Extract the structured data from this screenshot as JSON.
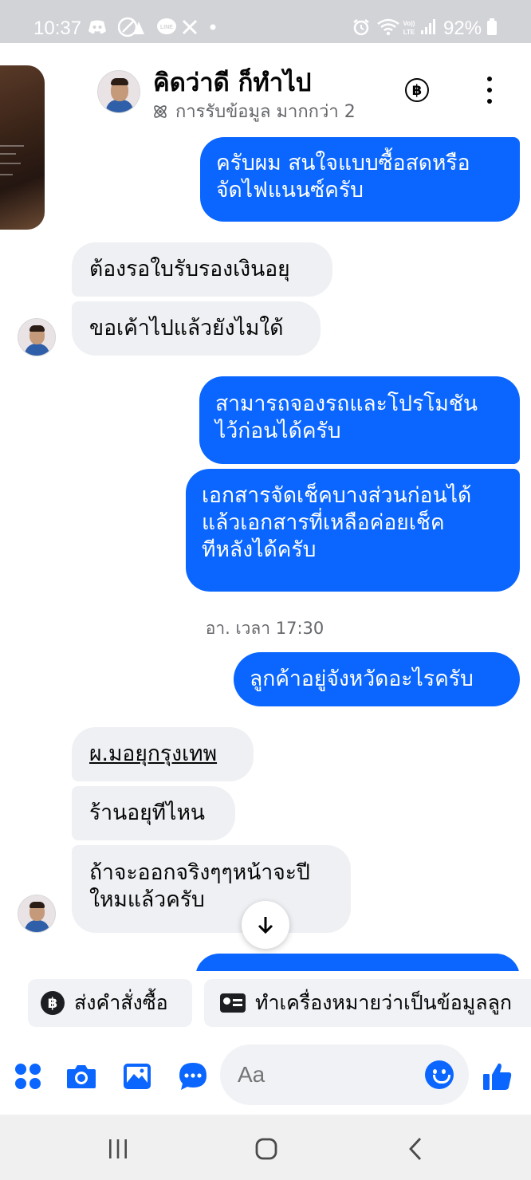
{
  "status_bar": {
    "time": "10:37",
    "battery": "92%",
    "notification_icons": [
      "discord-icon",
      "direction-icon",
      "line-icon",
      "x-icon",
      "dot-icon"
    ],
    "system_icons": [
      "alarm-icon",
      "wifi-icon",
      "volte-icon",
      "signal-icon",
      "battery-icon"
    ]
  },
  "header": {
    "title": "คิดว่าดี ก็ทำไป",
    "subtitle": "การรับข้อมูล มากกว่า 2",
    "baht_symbol": "฿"
  },
  "messages": [
    {
      "direction": "out",
      "text": "ครับผม สนใจแบบซื้อสดหรือ\nจัดไฟแนนซ์ครับ"
    },
    {
      "direction": "in",
      "text": "ต้องรอใบรับรองเงินอยุ"
    },
    {
      "direction": "in",
      "text": "ขอเค้าไปแล้วยังไมใด้"
    },
    {
      "direction": "out",
      "text": "สามารถจองรถและโปรโมชัน\nไว้ก่อนได้ครับ"
    },
    {
      "direction": "out",
      "text": "เอกสารจัดเช็คบางส่วนก่อนได้\nแล้วเอกสารที่เหลือค่อยเช็ค\nทีหลังได้ครับ"
    },
    {
      "direction": "out",
      "text": "ลูกค้าอยู่จังหวัดอะไรครับ"
    },
    {
      "direction": "in",
      "text": "ผ.มอยุกรุงเทพ"
    },
    {
      "direction": "in",
      "text": "ร้านอยุทีไหน"
    },
    {
      "direction": "in",
      "text": "ถ้าจะออกจริงๆๆหน้าจะปี\nใหมแล้วครับ"
    }
  ],
  "timestamp": "อา. เวลา 17:30",
  "quick_actions": [
    {
      "label": "ส่งคำสั่งซื้อ",
      "icon": "baht-icon",
      "icon_text": "฿"
    },
    {
      "label": "ทำเครื่องหมายว่าเป็นข้อมูลลูก",
      "icon": "contact-card-icon"
    }
  ],
  "composer": {
    "placeholder": "Aa"
  },
  "colors": {
    "outgoing_bubble": "#0a66ff",
    "incoming_bubble": "#eef0f3",
    "accent": "#0a66ff",
    "status_bar": "#d2d3d7"
  }
}
